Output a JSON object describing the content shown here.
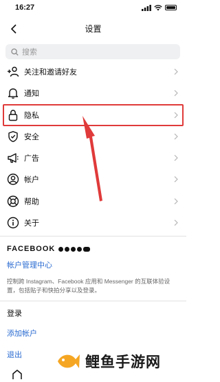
{
  "status_bar": {
    "time": "16:27"
  },
  "header": {
    "title": "设置"
  },
  "search": {
    "placeholder": "搜索"
  },
  "menu": [
    {
      "label": "关注和邀请好友",
      "icon": "add-person-icon"
    },
    {
      "label": "通知",
      "icon": "bell-icon"
    },
    {
      "label": "隐私",
      "icon": "lock-icon"
    },
    {
      "label": "安全",
      "icon": "shield-icon"
    },
    {
      "label": "广告",
      "icon": "megaphone-icon"
    },
    {
      "label": "帐户",
      "icon": "account-icon"
    },
    {
      "label": "帮助",
      "icon": "lifebuoy-icon"
    },
    {
      "label": "关于",
      "icon": "info-icon"
    }
  ],
  "facebook": {
    "brand": "FACEBOOK",
    "accounts_center": "帐户管理中心",
    "description": "控制跨 Instagram、Facebook 应用和 Messenger 的互联体验设置，包括贴子和快拍分享以及登录。"
  },
  "login": {
    "heading": "登录",
    "add_account": "添加帐户",
    "logout": "退出"
  },
  "watermark": {
    "text": "鲤鱼手游网"
  },
  "colors": {
    "link": "#2a6bd1",
    "highlight": "#e03a3a",
    "search_bg": "#eff0f2",
    "watermark_fish": "#f5a623"
  }
}
